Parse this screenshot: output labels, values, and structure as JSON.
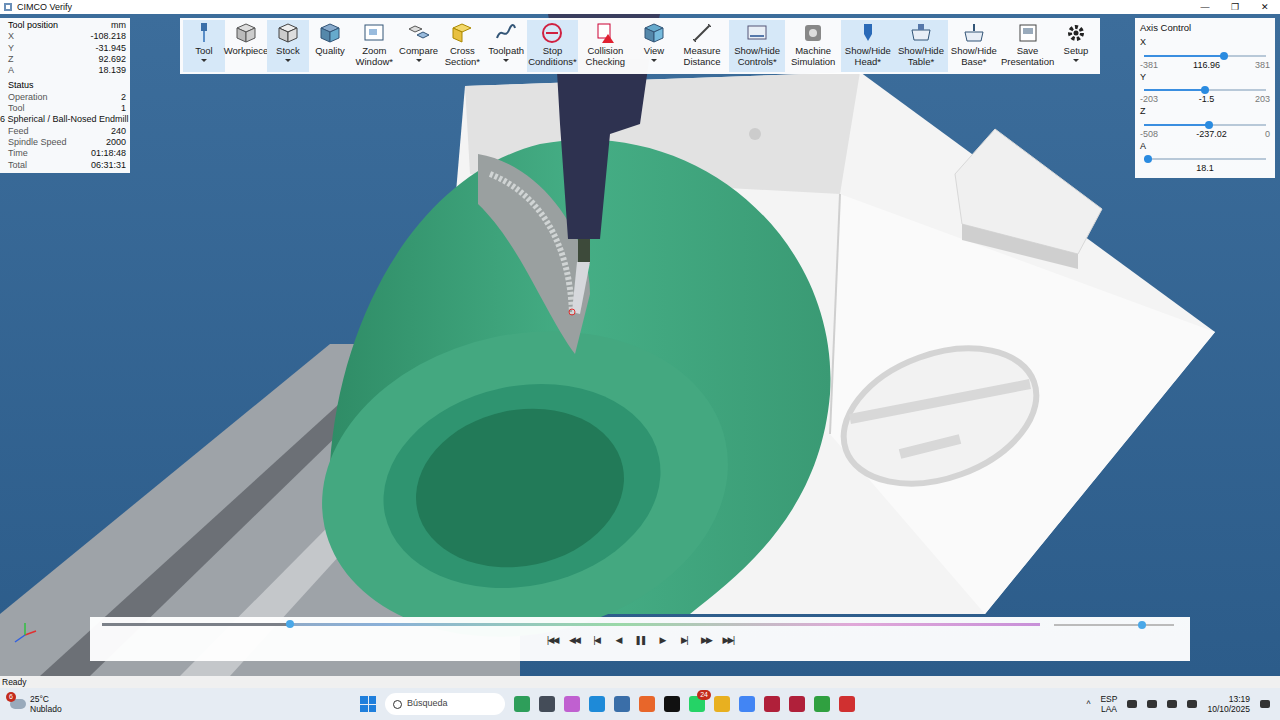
{
  "window": {
    "title": "CIMCO Verify",
    "controls": [
      "—",
      "❐",
      "✕"
    ]
  },
  "info": {
    "title": "Tool position",
    "unit": "mm",
    "position": [
      {
        "label": "X",
        "value": "-108.218"
      },
      {
        "label": "Y",
        "value": "-31.945"
      },
      {
        "label": "Z",
        "value": "92.692"
      },
      {
        "label": "A",
        "value": "18.139"
      }
    ],
    "status_title": "Status",
    "status": [
      {
        "kind": "pair",
        "label": "Operation",
        "value": "2"
      },
      {
        "kind": "pair",
        "label": "Tool",
        "value": "1"
      },
      {
        "kind": "note",
        "label": "6 Spherical / Ball-Nosed Endmill"
      },
      {
        "kind": "pair",
        "label": "Feed",
        "value": "240"
      },
      {
        "kind": "pair",
        "label": "Spindle Speed",
        "value": "2000"
      },
      {
        "kind": "pair",
        "label": "Time",
        "value": "01:18:48"
      },
      {
        "kind": "pair",
        "label": "Total",
        "value": "06:31:31"
      }
    ]
  },
  "toolbar": {
    "items": [
      {
        "label": "Tool",
        "selected": true,
        "menu": true
      },
      {
        "label": "Workpiece",
        "selected": false,
        "menu": false
      },
      {
        "label": "Stock",
        "selected": true,
        "menu": true
      },
      {
        "label": "Quality",
        "selected": false,
        "menu": false
      },
      {
        "label": "Zoom Window*",
        "selected": false,
        "menu": false
      },
      {
        "label": "Compare",
        "selected": false,
        "menu": true
      },
      {
        "label": "Cross Section*",
        "selected": false,
        "menu": false
      },
      {
        "label": "Toolpath",
        "selected": false,
        "menu": true
      },
      {
        "label": "Stop Conditions*",
        "selected": true,
        "menu": false
      },
      {
        "label": "Collision Checking",
        "selected": false,
        "menu": false
      },
      {
        "label": "View",
        "selected": false,
        "menu": true
      },
      {
        "label": "Measure Distance",
        "selected": false,
        "menu": false
      },
      {
        "label": "Show/Hide Controls*",
        "selected": true,
        "menu": false
      },
      {
        "label": "Machine Simulation",
        "selected": false,
        "menu": false
      },
      {
        "label": "Show/Hide Head*",
        "selected": true,
        "menu": false
      },
      {
        "label": "Show/Hide Table*",
        "selected": true,
        "menu": false
      },
      {
        "label": "Show/Hide Base*",
        "selected": false,
        "menu": false
      },
      {
        "label": "Save Presentation",
        "selected": false,
        "menu": false
      },
      {
        "label": "Setup",
        "selected": false,
        "menu": true
      }
    ]
  },
  "axis_control": {
    "title": "Axis Control",
    "axes": [
      {
        "label": "X",
        "min": "-381",
        "value": "116.96",
        "max": "381",
        "level": 0.653
      },
      {
        "label": "Y",
        "min": "-203",
        "value": "-1.5",
        "max": "203",
        "level": 0.496
      },
      {
        "label": "Z",
        "min": "-508",
        "value": "-237.02",
        "max": "0",
        "level": 0.533
      },
      {
        "label": "A",
        "value": "18.1",
        "level": 0.03
      }
    ]
  },
  "player": {
    "progress": 0.2,
    "speed": 0.73,
    "buttons": [
      "|◀◀",
      "◀◀",
      "|◀",
      "◀",
      "❚❚",
      "▶",
      "▶|",
      "▶▶",
      "▶▶|"
    ]
  },
  "status_bar": "Ready",
  "taskbar": {
    "weather": {
      "temp": "25°C",
      "condition": "Nublado",
      "badge": "6"
    },
    "search": {
      "placeholder": "Búsqueda"
    },
    "apps": [
      {
        "color": "#2e9e5a"
      },
      {
        "color": "#444c58"
      },
      {
        "color": "#c060d0"
      },
      {
        "color": "#1e8ad8"
      },
      {
        "color": "#3a6ea8"
      },
      {
        "color": "#e8662a"
      },
      {
        "color": "#111111"
      },
      {
        "color": "#25d366",
        "badge": "24"
      },
      {
        "color": "#e8b020"
      },
      {
        "color": "#4285f4"
      },
      {
        "color": "#b0203a"
      },
      {
        "color": "#b0203a"
      },
      {
        "color": "#30a040"
      },
      {
        "color": "#d03030"
      }
    ],
    "tray": {
      "chevron": "^",
      "lang": "ESP",
      "layout": "LAA",
      "time": "13:19",
      "date": "10/10/2025"
    }
  }
}
